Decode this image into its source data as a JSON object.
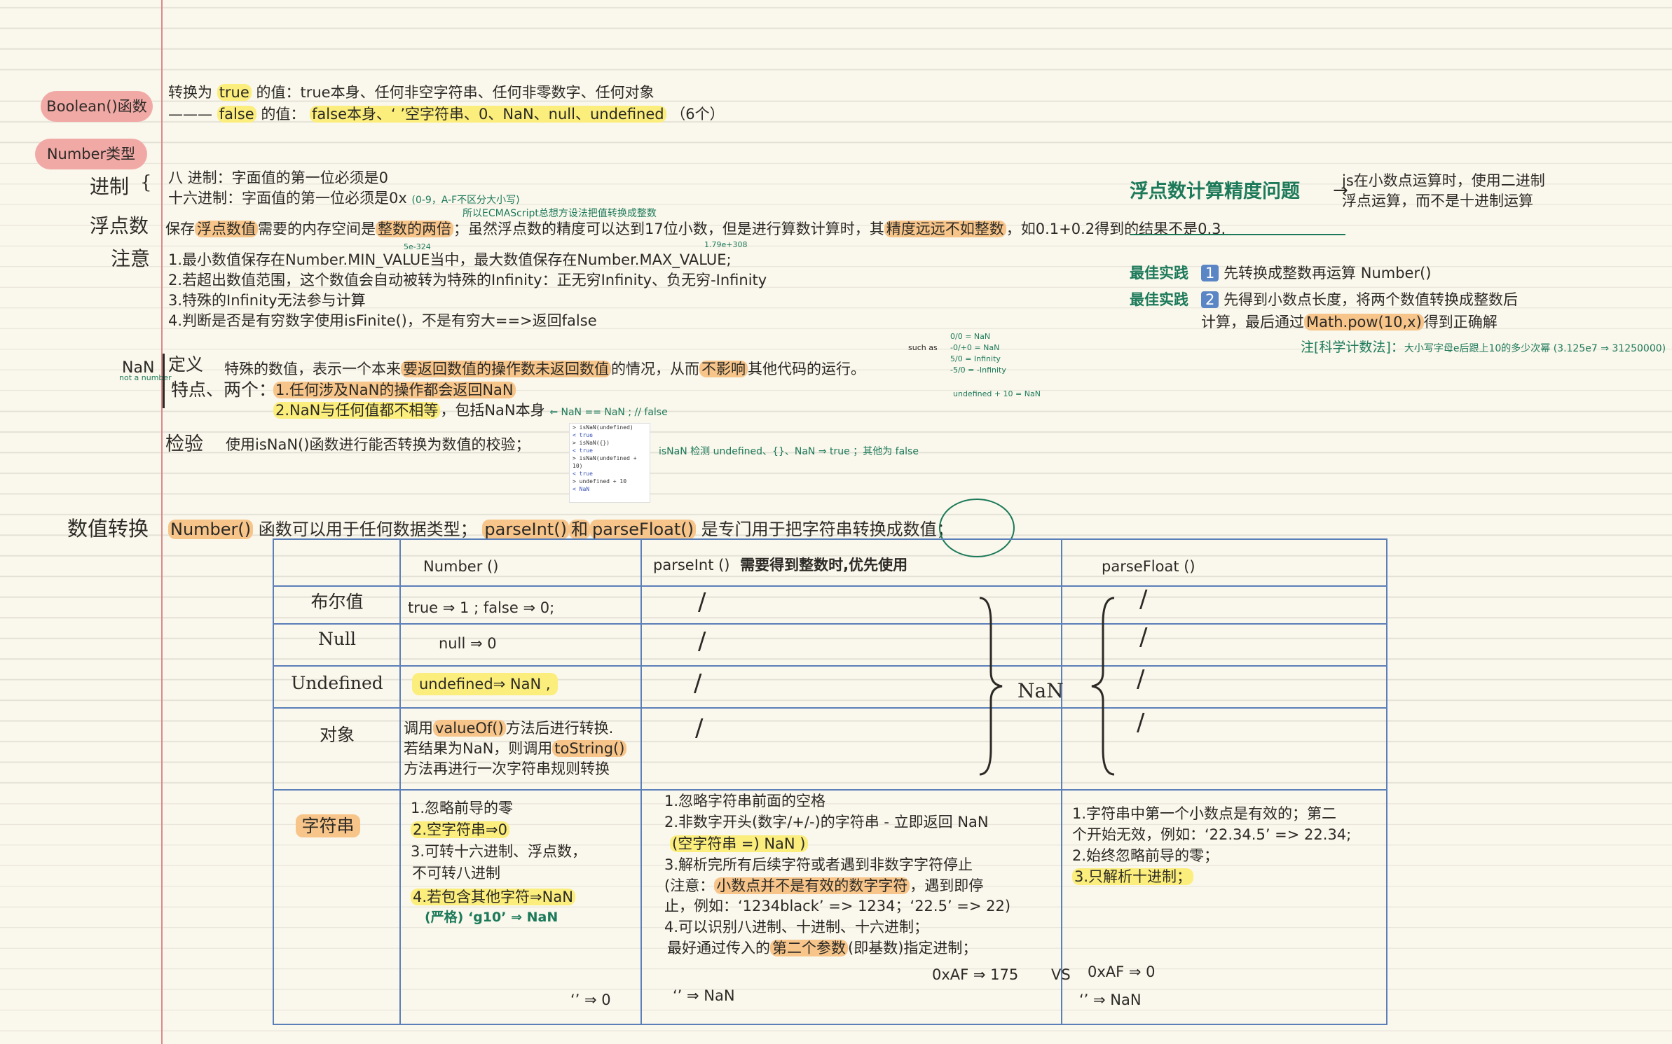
{
  "boolean": {
    "label": "Boolean()函数",
    "line1_prefix": "转换为",
    "line1_true": "true",
    "line1_mid": "的值：true本身、任何非空字符串、任何非零数字、任何对象",
    "line2_prefix": "———",
    "line2_false": "false",
    "line2_mid": "的值：",
    "line2_values": "false本身、‘ ’空字符串、0、NaN、null、undefined",
    "line2_count": "（6个）"
  },
  "number_type": {
    "label": "Number类型",
    "radix_label": "进制",
    "octal": "八  进制：字面值的第一位必须是0",
    "hex": "十六进制：字面值的第一位必须是0x",
    "hex_note": "(0-9，A-F不区分大小写)",
    "float_label": "浮点数",
    "float_note_small": "所以ECMAScript总想方设法把值转换成整数",
    "float_text_1": "保存",
    "float_hl_1": "浮点数值",
    "float_text_2": "需要的内存空间是",
    "float_hl_2": "整数的两倍",
    "float_text_3": "；虽然浮点数的精度可以达到17位小数，但是进行算数计算时，其",
    "float_hl_3": "精度远远不如整数",
    "float_text_4": "，如0.1+0.2得到的结果不是0.3.",
    "note_label": "注意",
    "note_small_1": "5e-324",
    "note_small_2": "1.79e+308",
    "note_1": "1.最小数值保存在Number.MIN_VALUE当中，最大数值保存在Number.MAX_VALUE;",
    "note_2": "2.若超出数值范围，这个数值会自动被转为特殊的Infinity：正无穷Infinity、负无穷-Infinity",
    "note_3": "3.特殊的Infinity无法参与计算",
    "note_4": "4.判断是否是有穷数字使用isFinite()，不是有穷大==>返回false"
  },
  "float_precision": {
    "title": "浮点数计算精度问题",
    "arrow": "→",
    "desc_1": "js在小数点运算时，使用二进制",
    "desc_2": "浮点运算，而不是十进制运算",
    "best_label": "最佳实践",
    "best_1_num": "1",
    "best_1": "先转换成整数再运算 Number()",
    "best_2_num": "2",
    "best_2a": "先得到小数点长度，将两个数值转换成整数后",
    "best_2b_pre": "计算，最后通过",
    "best_2b_hl": "Math.pow(10,x)",
    "best_2b_post": "得到正确解",
    "sci_note": "注[科学计数法]：",
    "sci_note_small": "大小写字母e后跟上10的多少次幂 (3.125e7 ⇒ 31250000)"
  },
  "nan": {
    "label": "NaN",
    "label_small": "not a number",
    "def_label": "定义",
    "def_text_1": "特殊的数值，表示一个本来",
    "def_hl": "要返回数值的操作数未返回数值",
    "def_text_2": "的情况，从而",
    "def_hl_2": "不影响",
    "def_text_3": "其他代码的运行。",
    "such_as": "such as",
    "examples": [
      "0/0 = NaN",
      "-0/+0 = NaN",
      "5/0 = Infinity",
      "-5/0 = -Infinity",
      "undefined + 10 = NaN"
    ],
    "feat_label": "特点、两个：",
    "feat_1": "1.任何涉及NaN的操作都会返回NaN",
    "feat_2": "2.NaN与任何值都不相等",
    "feat_2_suffix": "，包括NaN本身",
    "feat_2_note": "⇐ NaN == NaN ; // false",
    "check_label": "检验",
    "check_text": "使用isNaN()函数进行能否转换为数值的校验；",
    "check_note": "isNaN 检测 undefined、{}、NaN ⇒ true ；其他为 false",
    "console": [
      "> isNaN(undefined)",
      "< true",
      "> isNaN({})",
      "< true",
      "> isNaN(undefined + 10)",
      "< true",
      "> undefined + 10",
      "< NaN"
    ]
  },
  "conversion": {
    "label": "数值转换",
    "intro_1": "Number()",
    "intro_2": "函数可以用于任何数据类型；",
    "intro_3": "parseInt()",
    "intro_4": "和",
    "intro_5": "parseFloat()",
    "intro_6": "是专门用于把字符串转换成数值；",
    "headers": {
      "number": "Number ()",
      "parseint": "parseInt ()",
      "parseint_note": "需要得到整数时,优先使用",
      "parsefloat": "parseFloat ()"
    },
    "rows": {
      "bool": {
        "label": "布尔值",
        "number": "true ⇒ 1 ; false ⇒ 0;",
        "parseint": "/",
        "parsefloat": "/"
      },
      "null": {
        "label": "Null",
        "number": "null ⇒ 0",
        "parseint": "/",
        "parsefloat": "/"
      },
      "undefined": {
        "label": "Undefined",
        "number": "undefined⇒ NaN ,",
        "parseint": "/",
        "parsefloat": "/"
      },
      "object": {
        "label": "对象",
        "number_1_pre": "调用",
        "number_1_hl": "valueOf()",
        "number_1_post": "方法后进行转换.",
        "number_2_pre": "若结果为NaN，则调用",
        "number_2_hl": "toString()",
        "number_3": "方法再进行一次字符串规则转换",
        "parseint": "/",
        "parsefloat": "/"
      },
      "string": {
        "label": "字符串",
        "number": [
          "1.忽略前导的零",
          "2.空字符串⇒0",
          "3.可转十六进制、浮点数，",
          "不可转八进制",
          "4.若包含其他字符⇒NaN",
          "(严格)  ‘g10’ ⇒ NaN",
          "‘’ ⇒ 0"
        ],
        "parseint": [
          "1.忽略字符串前面的空格",
          "2.非数字开头(数字/+/-)的字符串 - 立即返回 NaN",
          "(空字符串 =) NaN )",
          "3.解析完所有后续字符或者遇到非数字字符停止",
          "(注意：",
          "小数点并不是有效的数字字符",
          "，遇到即停",
          "止，例如：‘1234black’ => 1234；‘22.5’ => 22)",
          "4.可以识别八进制、十进制、十六进制；",
          "最好通过传入的",
          "第二个参数",
          "(即基数)指定进制；",
          "‘’ ⇒ NaN"
        ],
        "parsefloat": [
          "1.字符串中第一个小数点是有效的；第二",
          "个开始无效，例如：‘22.34.5’ => 22.34;",
          "2.始终忽略前导的零；",
          "3.只解析十进制；",
          "‘’ ⇒ NaN"
        ],
        "compare": "0xAF ⇒ 175",
        "vs": "VS",
        "compare_2": "0xAF ⇒ 0"
      }
    },
    "nan_brace": "NaN"
  }
}
